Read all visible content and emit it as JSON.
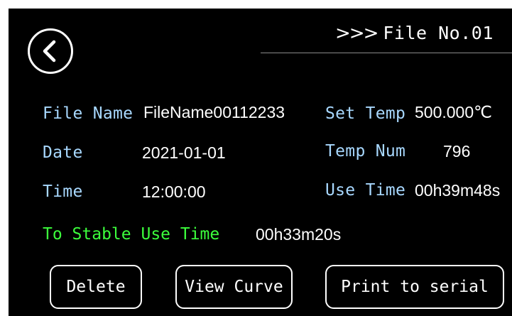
{
  "header": {
    "arrows": ">>>",
    "title": "File No.01"
  },
  "info": {
    "file_name_label": "File Name",
    "file_name_value": "FileName00112233",
    "set_temp_label": "Set Temp",
    "set_temp_value": "500.000℃",
    "date_label": "Date",
    "date_value": "2021-01-01",
    "temp_num_label": "Temp Num",
    "temp_num_value": "796",
    "time_label": "Time",
    "time_value": "12:00:00",
    "use_time_label": "Use Time",
    "use_time_value": "00h39m48s"
  },
  "stable": {
    "label": "To Stable Use Time",
    "value": "00h33m20s"
  },
  "buttons": {
    "delete": "Delete",
    "view_curve": "View Curve",
    "print": "Print to serial"
  },
  "colors": {
    "background": "#000000",
    "label": "#a8d8ff",
    "value": "#ffffff",
    "stable_label": "#3cff3c"
  },
  "icons": {
    "back": "back-arrow-icon"
  }
}
